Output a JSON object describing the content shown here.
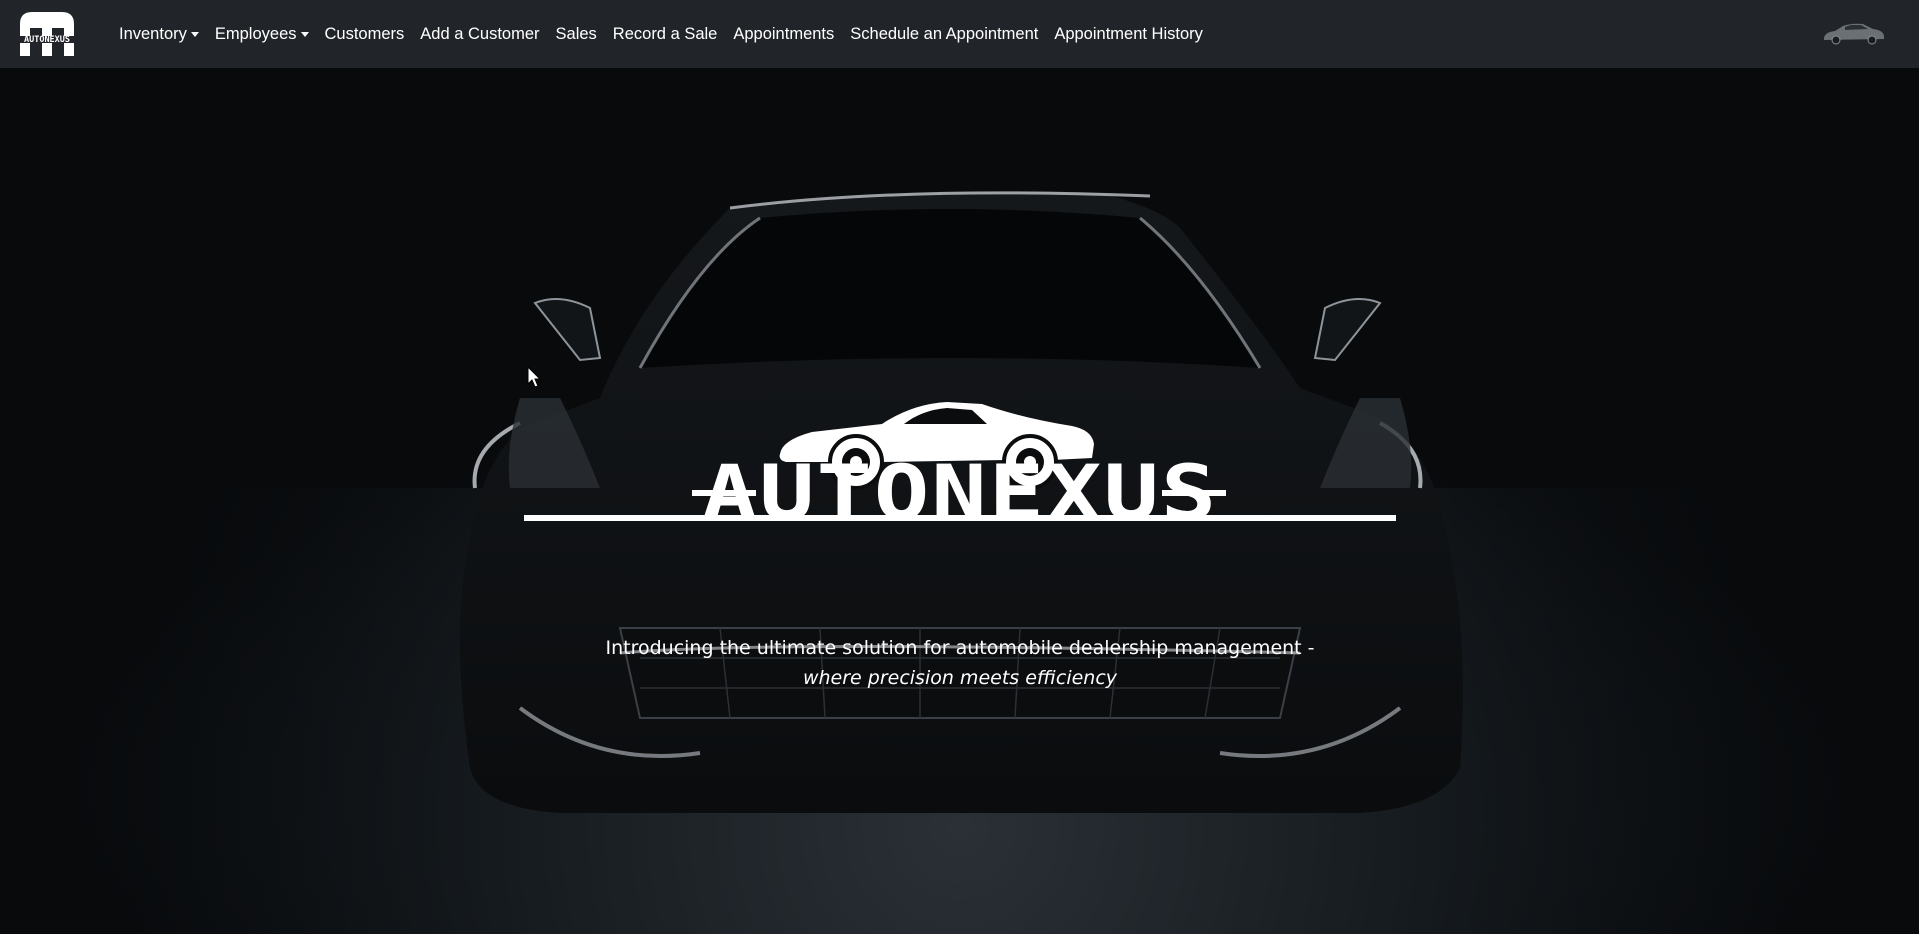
{
  "navbar": {
    "brand_logo_text": "AUTONEXUS",
    "items": [
      {
        "label": "Inventory",
        "dropdown": true
      },
      {
        "label": "Employees",
        "dropdown": true
      },
      {
        "label": "Customers",
        "dropdown": false
      },
      {
        "label": "Add a Customer",
        "dropdown": false
      },
      {
        "label": "Sales",
        "dropdown": false
      },
      {
        "label": "Record a Sale",
        "dropdown": false
      },
      {
        "label": "Appointments",
        "dropdown": false
      },
      {
        "label": "Schedule an Appointment",
        "dropdown": false
      },
      {
        "label": "Appointment History",
        "dropdown": false
      }
    ]
  },
  "hero": {
    "wordmark": "AUTONEXUS",
    "tagline_line1": "Introducing the ultimate solution for automobile dealership management -",
    "tagline_line2": "where precision meets efficiency"
  },
  "colors": {
    "navbar_bg": "#212529",
    "nav_text": "#ffffff",
    "hero_bg": "#07090b"
  }
}
